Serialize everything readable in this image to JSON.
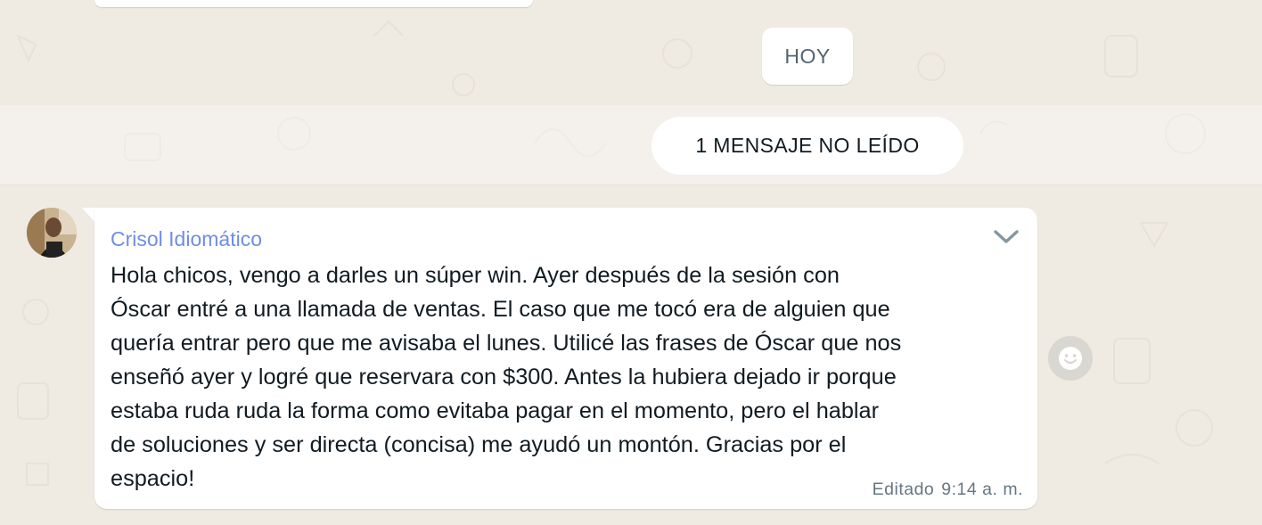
{
  "chat": {
    "date_separator": "HOY",
    "unread_banner": "1 MENSAJE NO LEÍDO"
  },
  "message": {
    "sender": "Crisol Idiomático",
    "sender_color": "#6f8de8",
    "text": "Hola chicos, vengo a darles un súper win. Ayer después de la sesión con\nÓscar entré a una llamada de ventas. El caso que me tocó era de alguien que\nquería entrar pero que me avisaba el lunes. Utilicé las frases de Óscar que nos\nenseñó ayer y logré que reservara con $300. Antes la hubiera dejado ir porque\nestaba ruda ruda la forma como evitaba pagar en el momento, pero el hablar\nde soluciones y ser directa (concisa) me ayudó un montón. Gracias por el\nespacio!",
    "edited_label": "Editado",
    "time": "9:14 a. m.",
    "menu_icon": "chevron-down-icon",
    "reaction_icon": "smiley-icon"
  },
  "colors": {
    "chat_background": "#efeae2",
    "bubble": "#ffffff",
    "meta_text": "#667781"
  }
}
